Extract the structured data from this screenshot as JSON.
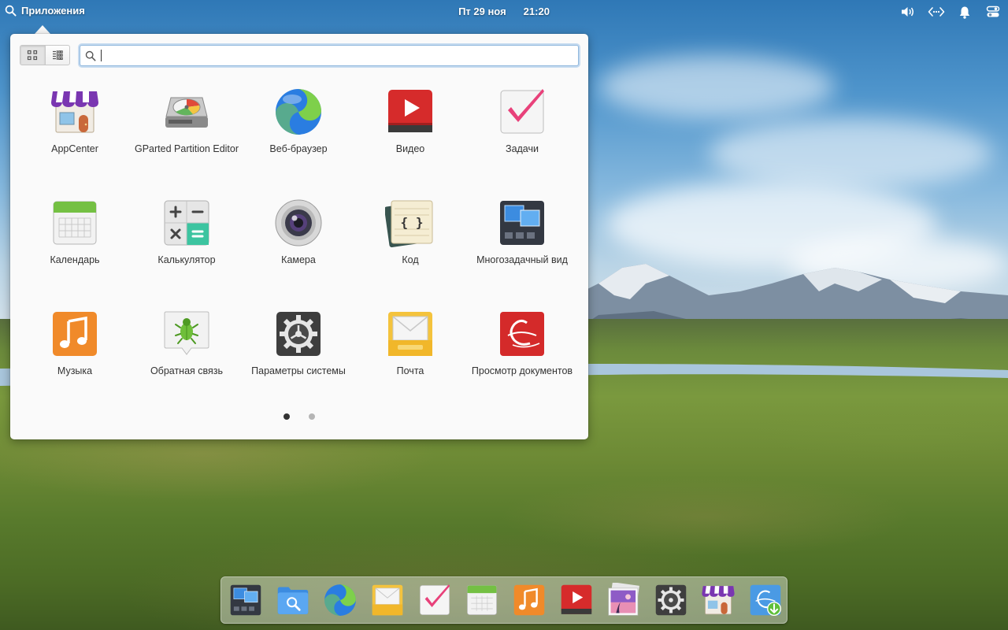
{
  "panel": {
    "launcher_label": "Приложения",
    "date": "Пт 29 ноя",
    "time": "21:20",
    "indicators": [
      "volume-icon",
      "network-icon",
      "notifications-icon",
      "session-icon"
    ]
  },
  "popover": {
    "view_modes": [
      "grid-view-icon",
      "category-view-icon"
    ],
    "search": {
      "value": "",
      "placeholder": ""
    },
    "apps": [
      {
        "label": "AppCenter",
        "icon": "appcenter-icon"
      },
      {
        "label": "GParted Partition Editor",
        "icon": "gparted-icon"
      },
      {
        "label": "Веб-браузер",
        "icon": "web-browser-icon"
      },
      {
        "label": "Видео",
        "icon": "videos-icon"
      },
      {
        "label": "Задачи",
        "icon": "tasks-icon"
      },
      {
        "label": "Календарь",
        "icon": "calendar-icon"
      },
      {
        "label": "Калькулятор",
        "icon": "calculator-icon"
      },
      {
        "label": "Камера",
        "icon": "camera-icon"
      },
      {
        "label": "Код",
        "icon": "code-icon"
      },
      {
        "label": "Многозадачный вид",
        "icon": "multitasking-view-icon"
      },
      {
        "label": "Музыка",
        "icon": "music-icon"
      },
      {
        "label": "Обратная связь",
        "icon": "feedback-icon"
      },
      {
        "label": "Параметры системы",
        "icon": "system-settings-icon"
      },
      {
        "label": "Почта",
        "icon": "mail-icon"
      },
      {
        "label": "Просмотр документов",
        "icon": "document-viewer-icon"
      }
    ],
    "pages": {
      "current": 1,
      "total": 2
    }
  },
  "dock": {
    "items": [
      "multitasking-view-icon",
      "files-icon",
      "web-browser-icon",
      "mail-icon",
      "tasks-icon",
      "calendar-icon",
      "music-icon",
      "videos-icon",
      "photos-icon",
      "system-settings-icon",
      "appcenter-icon",
      "installer-icon"
    ]
  },
  "colors": {
    "accent": "#3689e6",
    "popover_bg": "#fafafa",
    "label_text": "#333333"
  }
}
